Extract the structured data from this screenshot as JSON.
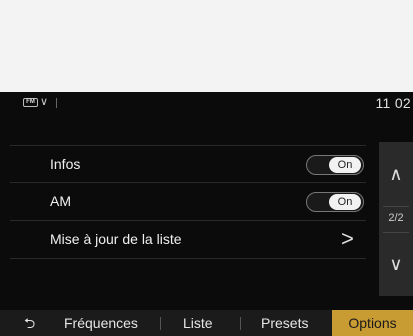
{
  "status": {
    "source_icon": "fm-radio-icon",
    "clock": "11 02"
  },
  "options": [
    {
      "label": "Infos",
      "type": "toggle",
      "value": "On"
    },
    {
      "label": "AM",
      "type": "toggle",
      "value": "On"
    },
    {
      "label": "Mise à jour de la liste",
      "type": "link",
      "arrow": ">"
    }
  ],
  "pager": {
    "up": "∧",
    "page": "2/2",
    "down": "∨"
  },
  "tabs": {
    "back": "⮌",
    "frequences": "Fréquences",
    "liste": "Liste",
    "presets": "Presets",
    "options": "Options"
  },
  "colors": {
    "accent": "#c89b33",
    "background": "#0b0b0b"
  }
}
